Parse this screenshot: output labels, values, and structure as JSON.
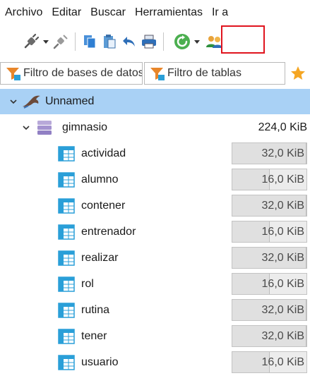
{
  "menu": [
    "Archivo",
    "Editar",
    "Buscar",
    "Herramientas",
    "Ir a"
  ],
  "filters": {
    "databases_placeholder": "Filtro de bases de datos",
    "tables_placeholder": "Filtro de tablas"
  },
  "colors": {
    "selection": "#a9d1f5",
    "highlight_box": "#e0141e",
    "table_icon": "#2a9fd8",
    "refresh_icon": "#4caf50"
  },
  "tree": {
    "session": {
      "label": "Unnamed",
      "icon": "dolphin-icon"
    },
    "database": {
      "label": "gimnasio",
      "size": "224,0 KiB",
      "icon": "database-icon"
    },
    "tables": [
      {
        "name": "actividad",
        "size": "32,0 KiB",
        "fill": 1.0
      },
      {
        "name": "alumno",
        "size": "16,0 KiB",
        "fill": 0.5
      },
      {
        "name": "contener",
        "size": "32,0 KiB",
        "fill": 1.0
      },
      {
        "name": "entrenador",
        "size": "16,0 KiB",
        "fill": 0.5
      },
      {
        "name": "realizar",
        "size": "32,0 KiB",
        "fill": 1.0
      },
      {
        "name": "rol",
        "size": "16,0 KiB",
        "fill": 0.5
      },
      {
        "name": "rutina",
        "size": "32,0 KiB",
        "fill": 1.0
      },
      {
        "name": "tener",
        "size": "32,0 KiB",
        "fill": 1.0
      },
      {
        "name": "usuario",
        "size": "16,0 KiB",
        "fill": 0.5
      }
    ]
  }
}
